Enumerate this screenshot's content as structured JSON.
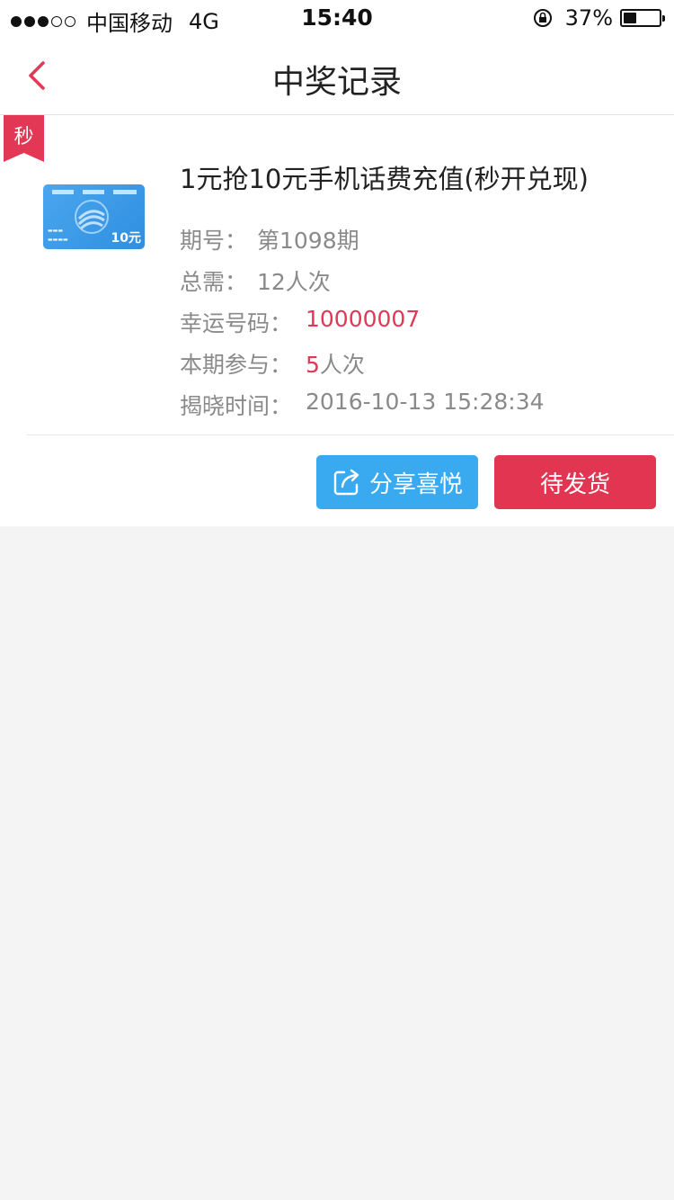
{
  "status_bar": {
    "carrier": "中国移动",
    "network": "4G",
    "time": "15:40",
    "battery_percent": "37%",
    "battery_level": 0.37
  },
  "nav": {
    "title": "中奖记录"
  },
  "record": {
    "badge": "秒",
    "product_title": "1元抢10元手机话费充值(秒开兑现)",
    "product_card_value": "10元",
    "issue_label": "期号：",
    "issue_value": "第1098期",
    "total_label": "总需：",
    "total_value": "12人次",
    "lucky_label": "幸运号码：",
    "lucky_value": "10000007",
    "participation_label": "本期参与：",
    "participation_count": "5",
    "participation_unit": "人次",
    "reveal_label": "揭晓时间：",
    "reveal_value": "2016-10-13 15:28:34"
  },
  "actions": {
    "share_label": "分享喜悦",
    "ship_label": "待发货"
  },
  "colors": {
    "accent_red": "#e23855",
    "share_blue": "#3aaaf0",
    "page_bg": "#f4f4f4"
  }
}
